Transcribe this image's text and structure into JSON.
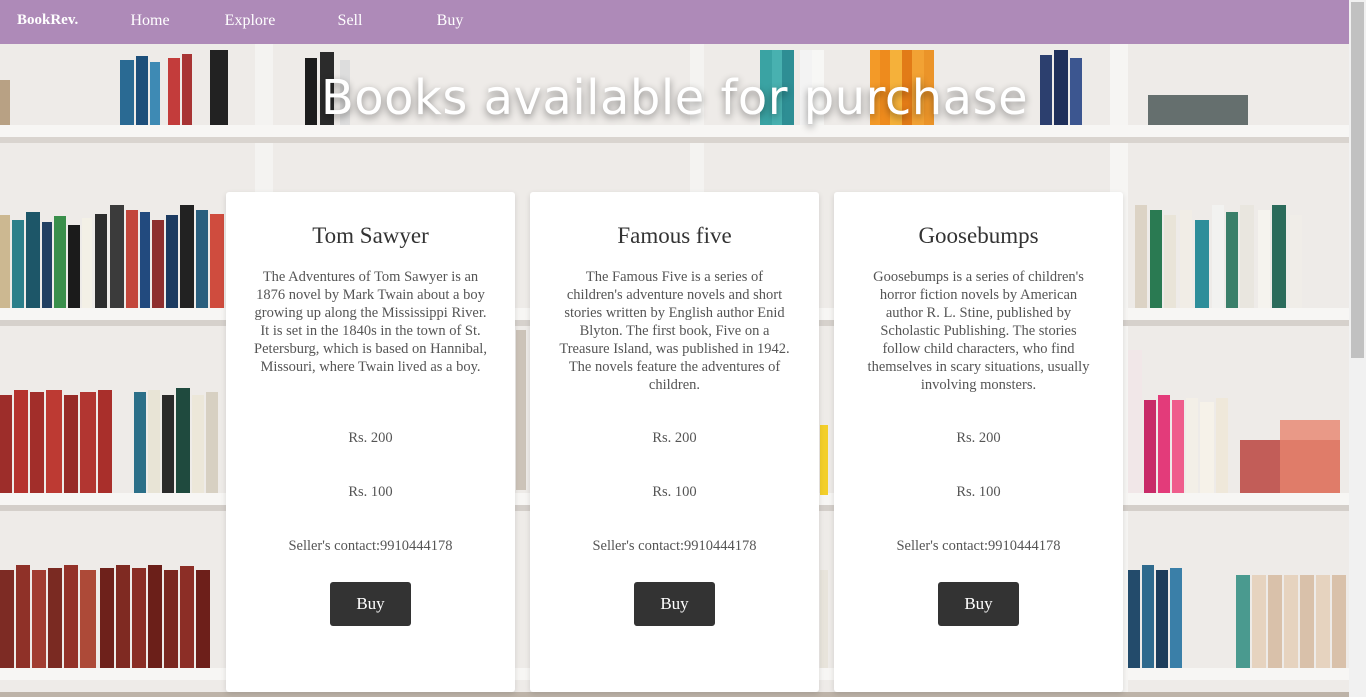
{
  "nav": {
    "brand": "BookRev.",
    "links": [
      "Home",
      "Explore",
      "Sell",
      "Buy"
    ]
  },
  "heading": "Books available for purchase",
  "cards": [
    {
      "title": "Tom Sawyer",
      "description": "The Adventures of Tom Sawyer is an 1876 novel by Mark Twain about a boy growing up along the Mississippi River. It is set in the 1840s in the town of St. Petersburg, which is based on Hannibal, Missouri, where Twain lived as a boy.",
      "price_original": "Rs. 200",
      "price_offer": "Rs. 100",
      "contact": "Seller's contact:9910444178",
      "button": "Buy"
    },
    {
      "title": "Famous five",
      "description": "The Famous Five is a series of children's adventure novels and short stories written by English author Enid Blyton. The first book, Five on a Treasure Island, was published in 1942. The novels feature the adventures of children.",
      "price_original": "Rs. 200",
      "price_offer": "Rs. 100",
      "contact": "Seller's contact:9910444178",
      "button": "Buy"
    },
    {
      "title": "Goosebumps",
      "description": "Goosebumps is a series of children's horror fiction novels by American author R. L. Stine, published by Scholastic Publishing. The stories follow child characters, who find themselves in scary situations, usually involving monsters.",
      "price_original": "Rs. 200",
      "price_offer": "Rs. 100",
      "contact": "Seller's contact:9910444178",
      "button": "Buy"
    }
  ],
  "colors": {
    "navbar": "#ae8ab8",
    "button": "#333333",
    "card": "#ffffff"
  }
}
